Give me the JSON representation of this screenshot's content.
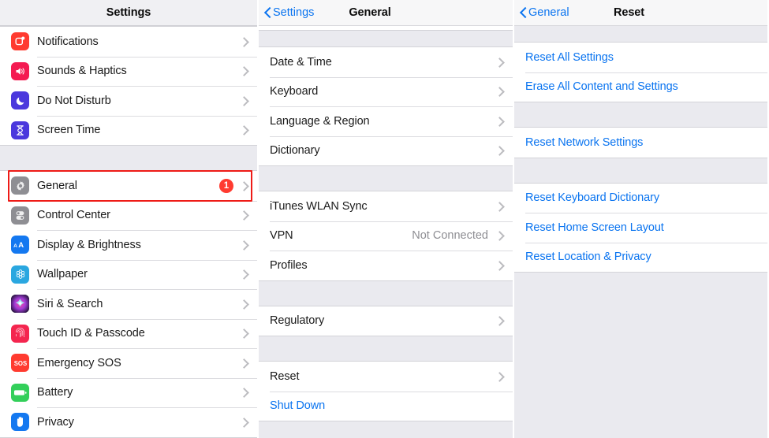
{
  "left_panel": {
    "nav": {
      "title": "Settings"
    },
    "groups": [
      {
        "rows": [
          {
            "label": "Notifications",
            "icon": "notifications-icon",
            "chevron": true
          },
          {
            "label": "Sounds & Haptics",
            "icon": "sounds-haptics-icon",
            "chevron": true
          },
          {
            "label": "Do Not Disturb",
            "icon": "do-not-disturb-icon",
            "chevron": true
          },
          {
            "label": "Screen Time",
            "icon": "screen-time-icon",
            "chevron": true
          }
        ]
      },
      {
        "rows": [
          {
            "label": "General",
            "icon": "general-icon",
            "badge": "1",
            "chevron": true,
            "highlighted": true
          },
          {
            "label": "Control Center",
            "icon": "control-center-icon",
            "chevron": true
          },
          {
            "label": "Display & Brightness",
            "icon": "display-brightness-icon",
            "chevron": true
          },
          {
            "label": "Wallpaper",
            "icon": "wallpaper-icon",
            "chevron": true
          },
          {
            "label": "Siri & Search",
            "icon": "siri-search-icon",
            "chevron": true
          },
          {
            "label": "Touch ID & Passcode",
            "icon": "touch-id-icon",
            "chevron": true
          },
          {
            "label": "Emergency SOS",
            "icon": "emergency-sos-icon",
            "chevron": true
          },
          {
            "label": "Battery",
            "icon": "battery-icon",
            "chevron": true
          },
          {
            "label": "Privacy",
            "icon": "privacy-icon",
            "chevron": true
          }
        ]
      }
    ]
  },
  "middle_panel": {
    "nav": {
      "back_label": "Settings",
      "title": "General"
    },
    "groups": [
      {
        "rows": [
          {
            "label": "Date & Time",
            "chevron": true
          },
          {
            "label": "Keyboard",
            "chevron": true
          },
          {
            "label": "Language & Region",
            "chevron": true
          },
          {
            "label": "Dictionary",
            "chevron": true
          }
        ]
      },
      {
        "rows": [
          {
            "label": "iTunes WLAN Sync",
            "chevron": true
          },
          {
            "label": "VPN",
            "value": "Not Connected",
            "chevron": true
          },
          {
            "label": "Profiles",
            "chevron": true
          }
        ]
      },
      {
        "rows": [
          {
            "label": "Regulatory",
            "chevron": true
          }
        ]
      },
      {
        "rows": [
          {
            "label": "Reset",
            "chevron": true,
            "highlighted": true
          },
          {
            "label": "Shut Down",
            "link": true
          }
        ]
      }
    ]
  },
  "right_panel": {
    "nav": {
      "back_label": "General",
      "title": "Reset"
    },
    "groups": [
      {
        "rows": [
          {
            "label": "Reset All Settings",
            "link": true
          },
          {
            "label": "Erase All Content and Settings",
            "link": true,
            "highlighted": true
          }
        ]
      },
      {
        "rows": [
          {
            "label": "Reset Network Settings",
            "link": true
          }
        ]
      },
      {
        "rows": [
          {
            "label": "Reset Keyboard Dictionary",
            "link": true
          },
          {
            "label": "Reset Home Screen Layout",
            "link": true
          },
          {
            "label": "Reset Location & Privacy",
            "link": true
          }
        ]
      }
    ]
  },
  "colors": {
    "ios_blue": "#0a74f0",
    "badge_red": "#ff3b30",
    "highlight_red": "#ee1b17",
    "panel_bg": "#eaeaef",
    "row_bg": "#ffffff",
    "value_gray": "#8e8e93"
  }
}
